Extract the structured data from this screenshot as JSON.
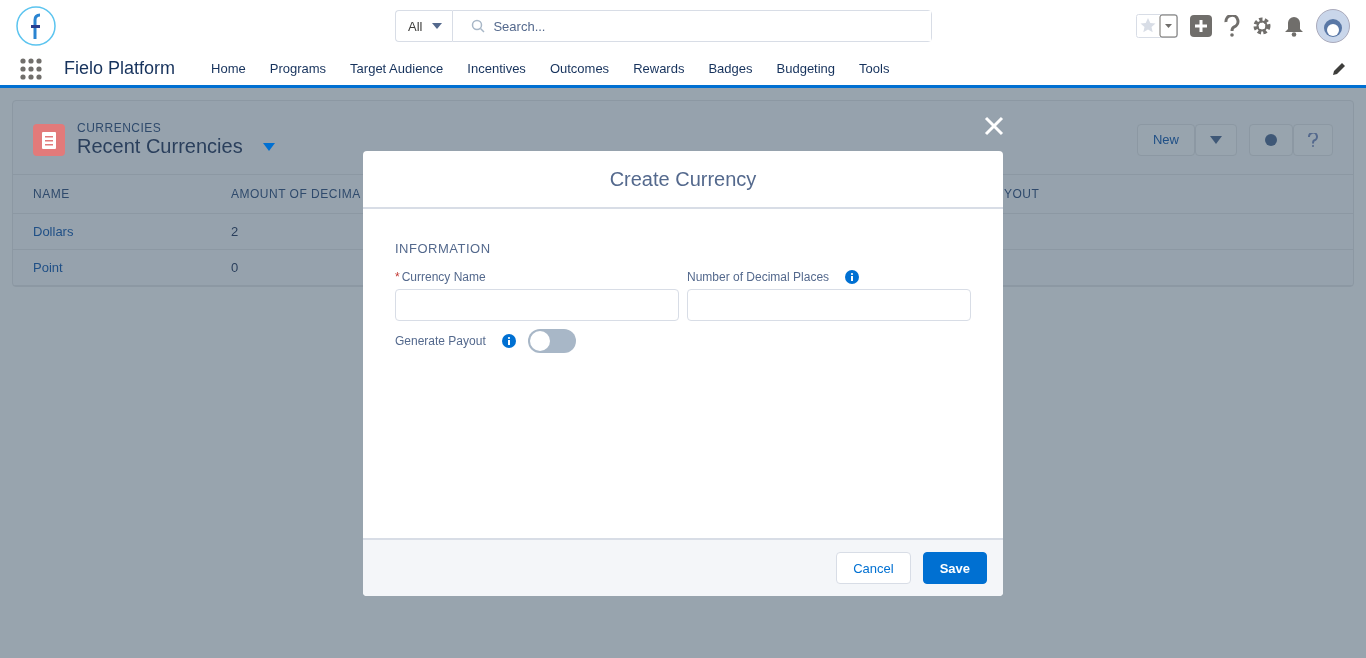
{
  "header": {
    "search_scope": "All",
    "search": {
      "placeholder": "Search..."
    }
  },
  "nav": {
    "app_name": "Fielo Platform",
    "items": [
      {
        "label": "Home",
        "selected": false
      },
      {
        "label": "Programs",
        "selected": false
      },
      {
        "label": "Target Audience",
        "selected": false
      },
      {
        "label": "Incentives",
        "selected": false
      },
      {
        "label": "Outcomes",
        "selected": false
      },
      {
        "label": "Rewards",
        "selected": false
      },
      {
        "label": "Badges",
        "selected": false
      },
      {
        "label": "Budgeting",
        "selected": false
      },
      {
        "label": "Tools",
        "selected": false
      }
    ]
  },
  "list_view": {
    "object": "CURRENCIES",
    "title": "Recent Currencies",
    "new_button": "New",
    "columns": [
      "NAME",
      "AMOUNT OF DECIMA",
      "YOUT"
    ],
    "rows": [
      {
        "name": "Dollars",
        "decimals": "2"
      },
      {
        "name": "Point",
        "decimals": "0"
      }
    ]
  },
  "modal": {
    "title": "Create Currency",
    "section": "INFORMATION",
    "fields": [
      {
        "label": "Currency Name",
        "required_mark": "*",
        "info": false
      },
      {
        "label": "Number of Decimal Places",
        "info": true
      }
    ],
    "toggle": {
      "label": "Generate Payout",
      "on": false
    },
    "buttons": [
      {
        "label": "Cancel",
        "kind": "neutral"
      },
      {
        "label": "Save",
        "kind": "brand"
      }
    ]
  }
}
